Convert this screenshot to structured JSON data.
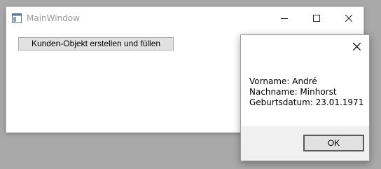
{
  "main_window": {
    "title": "MainWindow",
    "controls": {
      "minimize_icon": "minimize-icon",
      "maximize_icon": "maximize-icon",
      "close_icon": "close-icon"
    },
    "button_label": "Kunden-Objekt erstellen und füllen"
  },
  "message_box": {
    "lines": [
      "Vorname: André",
      "Nachname: Minhorst",
      "Geburtsdatum: 23.01.1971"
    ],
    "ok_label": "OK",
    "close_icon": "close-icon"
  },
  "colors": {
    "desktop": "#a9a9a9",
    "title_text": "#9a9a9a",
    "button_face": "#e1e1e1",
    "footer": "#f0f0f0"
  }
}
